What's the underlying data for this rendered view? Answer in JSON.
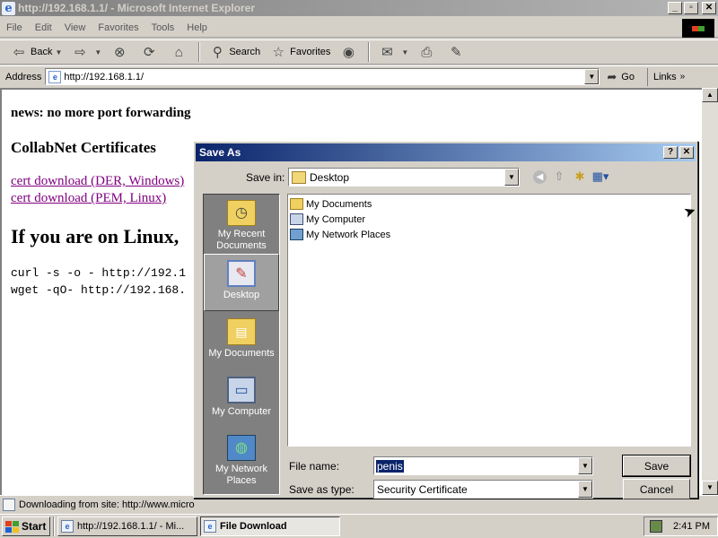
{
  "window": {
    "title": "http://192.168.1.1/ - Microsoft Internet Explorer",
    "minimize": "_",
    "maximize": "▫",
    "close": "✕"
  },
  "menu": [
    "File",
    "Edit",
    "View",
    "Favorites",
    "Tools",
    "Help"
  ],
  "toolbar": {
    "back_label": "Back",
    "search_label": "Search",
    "favorites_label": "Favorites"
  },
  "address": {
    "label": "Address",
    "url": "http://192.168.1.1/",
    "go_label": "Go",
    "links_label": "Links"
  },
  "page": {
    "news": "news: no more port forwarding",
    "cert_heading": "CollabNet Certificates",
    "link_der": "cert download (DER, Windows)",
    "link_pem": "cert download (PEM, Linux)",
    "linux_heading": "If you are on Linux,",
    "code_curl": "curl -s -o - http://192.1",
    "code_wget": "wget -qO- http://192.168."
  },
  "status": {
    "text": "Downloading from site: http://www.micro"
  },
  "taskbar": {
    "start_label": "Start",
    "tasks": [
      {
        "label": "http://192.168.1.1/ - Mi...",
        "active": false
      },
      {
        "label": "File Download",
        "active": true
      }
    ],
    "clock": "2:41 PM"
  },
  "dialog": {
    "title": "Save As",
    "help": "?",
    "close": "✕",
    "save_in_label": "Save in:",
    "save_in_value": "Desktop",
    "places": [
      {
        "label": "My Recent Documents",
        "icon": "recent-documents-icon"
      },
      {
        "label": "Desktop",
        "icon": "desktop-icon"
      },
      {
        "label": "My Documents",
        "icon": "my-documents-icon"
      },
      {
        "label": "My Computer",
        "icon": "my-computer-icon"
      },
      {
        "label": "My Network Places",
        "icon": "network-places-icon"
      }
    ],
    "files": [
      {
        "label": "My Documents",
        "icon": "folder-icon"
      },
      {
        "label": "My Computer",
        "icon": "computer-icon"
      },
      {
        "label": "My Network Places",
        "icon": "network-icon"
      }
    ],
    "file_name_label": "File name:",
    "file_name_value": "penis",
    "save_as_type_label": "Save as type:",
    "save_as_type_value": "Security Certificate",
    "save_button": "Save",
    "cancel_button": "Cancel"
  }
}
